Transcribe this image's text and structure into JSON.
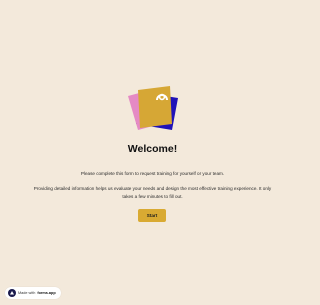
{
  "welcome": {
    "title": "Welcome!",
    "intro": "Please complete this form to request training for yourself or your team.",
    "description": "Providing detailed information helps us evaluate your needs and design the most effective training experience. It only takes a few minutes to fill out."
  },
  "actions": {
    "start_label": "Start"
  },
  "footer": {
    "made_with": "Made with",
    "brand": "forms.app"
  },
  "colors": {
    "background": "#f3e9db",
    "accent": "#d9aa32",
    "card_pink": "#e58ac4",
    "card_navy": "#1f12b8",
    "card_gold": "#d6a735"
  },
  "icons": {
    "hero": "folder-stack-illustration",
    "badge": "forms-app-logo-icon"
  }
}
